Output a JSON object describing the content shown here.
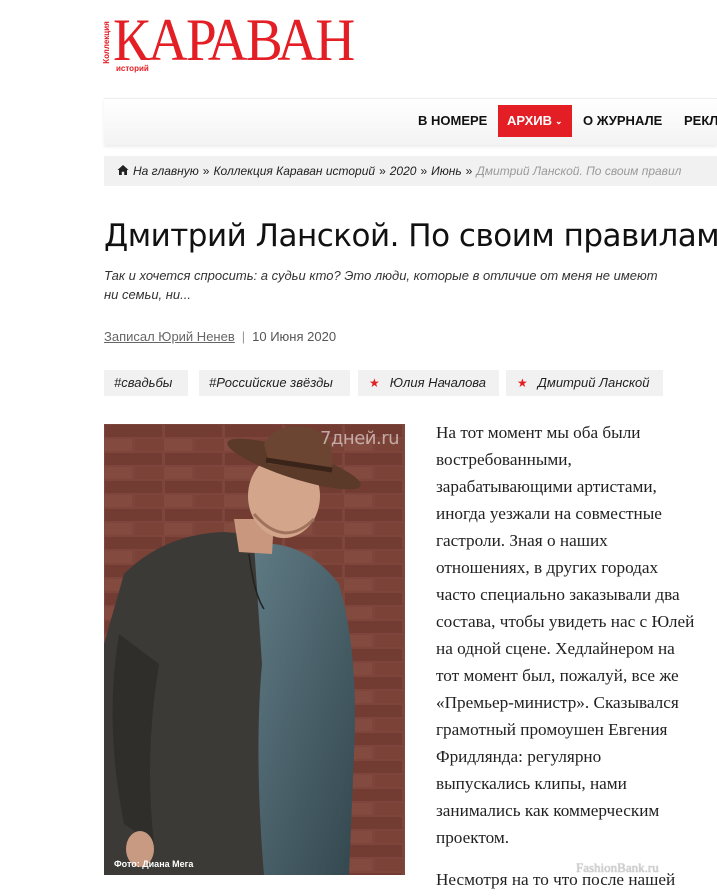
{
  "logo": {
    "side_text": "Коллекция",
    "main_text": "КАРАВАН",
    "sub_text": "историй",
    "color": "#e31e24"
  },
  "nav": {
    "items": [
      {
        "label": "В НОМЕРЕ"
      },
      {
        "label": "АРХИВ",
        "active": true
      },
      {
        "label": "О ЖУРНАЛЕ"
      },
      {
        "label": "РЕКЛ"
      }
    ]
  },
  "breadcrumb": {
    "home_icon": "home-icon",
    "items": [
      "На главную",
      "Коллекция Караван историй",
      "2020",
      "Июнь"
    ],
    "current": "Дмитрий Ланской. По своим правил"
  },
  "article": {
    "title": "Дмитрий Ланской. По своим правилам",
    "lead_lines": [
      "Так и хочется спросить: а судьи кто? Это люди, которые в отличие от меня не имеют",
      "ни семьи, ни..."
    ],
    "author": "Записал Юрий Ненев",
    "date": "10 Июня 2020",
    "tags": [
      {
        "label": "#свадьбы",
        "star": false
      },
      {
        "label": "#Российские звёзды",
        "star": false
      },
      {
        "label": "Юлия Началова",
        "star": true
      },
      {
        "label": "Дмитрий Ланской",
        "star": true
      }
    ],
    "photo": {
      "watermark": "7дней.ru",
      "credit": "Фото: Диана Мега"
    },
    "body_lines_p1": [
      "На тот момент мы оба были",
      "востребованными,",
      "зарабатывающими артистами,",
      "иногда уезжали на совместные",
      "гастроли. Зная о наших",
      "отношениях, в других городах",
      "часто специально заказывали два",
      "состава, чтобы увидеть нас с Юлей",
      "на одной сцене. Хедлайнером на",
      "тот момент был, пожалуй, все же",
      "«Премьер-министр». Сказывался",
      "грамотный промоушен Евгения",
      "Фридлянда: регулярно",
      "выпускались клипы, нами",
      "занимались как коммерческим",
      "проектом."
    ],
    "body_lines_p2": [
      "Несмотря на то что после нашей"
    ]
  },
  "site_watermark": "FashionBank.ru",
  "colors": {
    "accent": "#e31e24",
    "crumb_bg": "#f1f1f1"
  }
}
